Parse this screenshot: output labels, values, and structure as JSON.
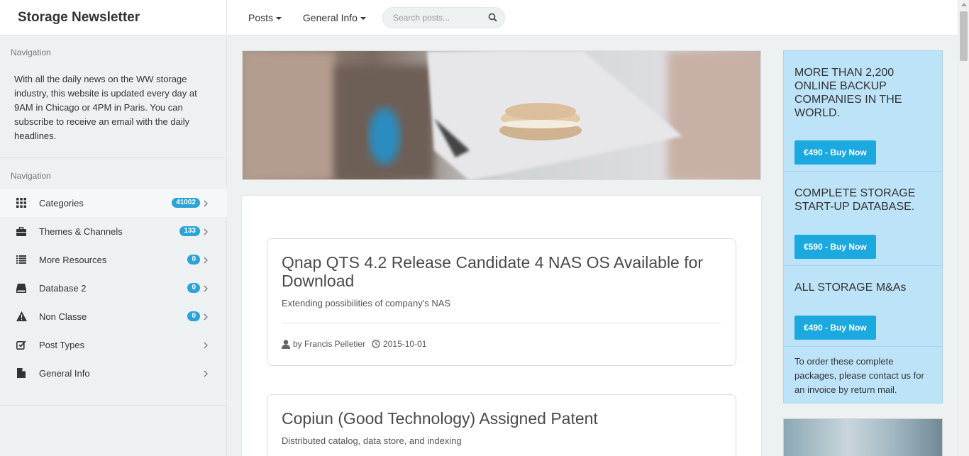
{
  "header": {
    "brand": "Storage Newsletter",
    "nav": [
      {
        "label": "Posts"
      },
      {
        "label": "General Info"
      }
    ],
    "search_placeholder": "Search posts..."
  },
  "sidebar": {
    "heading1": "Navigation",
    "description": "With all the daily news on the WW storage industry, this website is updated every day at 9AM in Chicago or 4PM in Paris. You can subscribe to receive an email with the daily headlines.",
    "heading2": "Navigation",
    "items": [
      {
        "label": "Categories",
        "badge": "41002",
        "icon": "grid-icon"
      },
      {
        "label": "Themes & Channels",
        "badge": "133",
        "icon": "briefcase-icon"
      },
      {
        "label": "More Resources",
        "badge": "0",
        "icon": "list-icon"
      },
      {
        "label": "Database 2",
        "badge": "0",
        "icon": "drive-icon"
      },
      {
        "label": "Non Classe",
        "badge": "0",
        "icon": "warning-icon"
      },
      {
        "label": "Post Types",
        "badge": "",
        "icon": "edit-icon"
      },
      {
        "label": "General Info",
        "badge": "",
        "icon": "file-icon"
      }
    ]
  },
  "posts": [
    {
      "title": "Qnap QTS 4.2 Release Candidate 4 NAS OS Available for Download",
      "subtitle": "Extending possibilities of company's NAS",
      "author": "by Francis Pelletier",
      "date": "2015-10-01"
    },
    {
      "title": "Copiun (Good Technology) Assigned Patent",
      "subtitle": "Distributed catalog, data store, and indexing"
    }
  ],
  "promo": {
    "blocks": [
      {
        "title": "MORE THAN 2,200 ONLINE BACKUP COMPANIES IN THE WORLD.",
        "button": "€490 - Buy Now"
      },
      {
        "title": "COMPLETE STORAGE START-UP DATABASE.",
        "button": "€590 - Buy Now"
      },
      {
        "title": "ALL STORAGE M&As",
        "button": "€490 - Buy Now"
      }
    ],
    "note": "To order these complete packages, please contact us for an invoice by return mail."
  },
  "colors": {
    "accent": "#2ba3d8",
    "button": "#1ba9df",
    "promo_bg": "#bde3f8"
  }
}
